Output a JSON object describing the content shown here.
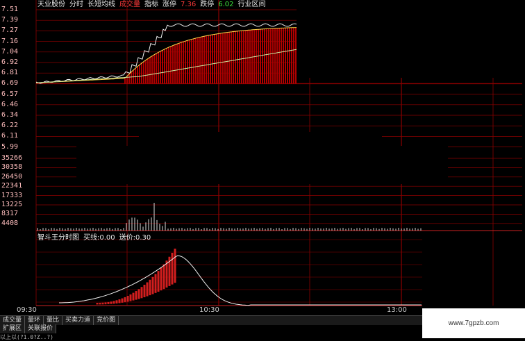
{
  "header": {
    "stock_name": "天业股份",
    "tabs": [
      "分时",
      "长短均线"
    ],
    "volume_label": "成交量",
    "indicator_label": "指标",
    "limit_up_label": "涨停",
    "limit_up_value": "7.36",
    "limit_down_label": "跌停",
    "limit_down_value": "6.02",
    "sector_label": "行业区间"
  },
  "price_axis": [
    "7.51",
    "7.39",
    "7.27",
    "7.16",
    "7.04",
    "6.92",
    "6.81",
    "6.69",
    "6.57",
    "6.46",
    "6.34",
    "6.22",
    "6.11",
    "5.99"
  ],
  "volume_axis": [
    "35266",
    "30358",
    "26450",
    "22341",
    "17333",
    "13225",
    "8317",
    "4408"
  ],
  "indicator": {
    "title": "智斗王分时图",
    "buy_label": "买线:0.00",
    "line_label": "送价:0.30"
  },
  "time_axis": [
    "09:30",
    "10:30",
    "13:00"
  ],
  "bottom_tabs": [
    "成交量",
    "量环",
    "量比",
    "买卖力道",
    "竞价图"
  ],
  "bottom_tabs2": [
    "扩展区",
    "关联报价"
  ],
  "watermark": "www.7gpzb.com",
  "status_text": "以上以(?1.0?Z..?)",
  "colors": {
    "grid": "#8b0000",
    "price_line": "#f0f0f0",
    "avg_line": "#ffd84a",
    "volume_bar": "#b00000",
    "accent_red": "#ff3a3a"
  }
}
